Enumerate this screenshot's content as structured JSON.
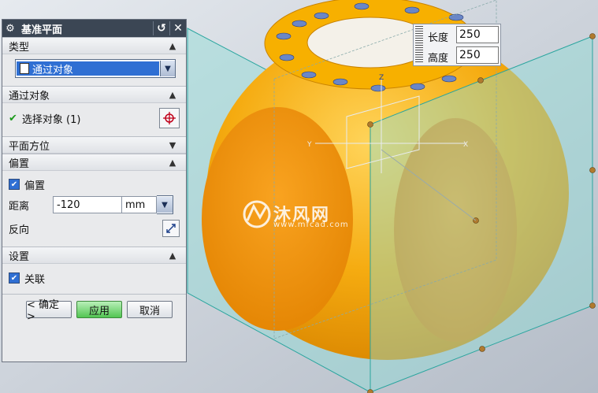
{
  "dialog": {
    "title": "基准平面",
    "sections": {
      "type": {
        "header": "类型",
        "select_value": "通过对象"
      },
      "through_object": {
        "header": "通过对象",
        "select_label": "选择对象 (1)"
      },
      "plane_orientation": {
        "header": "平面方位"
      },
      "offset": {
        "header": "偏置",
        "checkbox_label": "偏置",
        "distance_label": "距离",
        "distance_value": "-120",
        "unit": "mm",
        "reverse_label": "反向"
      },
      "settings": {
        "header": "设置",
        "associative_label": "关联"
      }
    },
    "buttons": {
      "ok": "< 确定 >",
      "apply": "应用",
      "cancel": "取消"
    }
  },
  "size_popup": {
    "length_label": "长度",
    "length_value": "250",
    "height_label": "高度",
    "height_value": "250"
  },
  "watermark": {
    "text": "沐风网",
    "url": "www.mfcad.com"
  },
  "axes": {
    "x": "X",
    "y": "Y",
    "z": "Z"
  },
  "colors": {
    "sphere": "#f2a400",
    "plane": "#7fd6d2",
    "background": "#c9d0d9"
  }
}
